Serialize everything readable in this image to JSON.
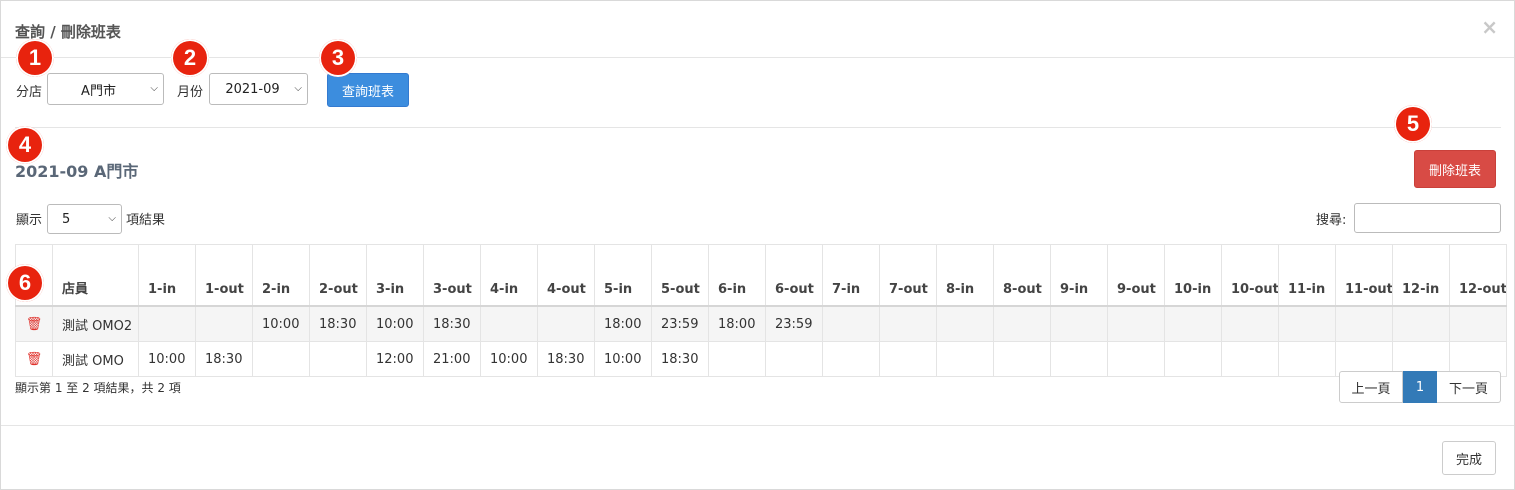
{
  "modal": {
    "title": "查詢 / 刪除班表",
    "close_glyph": "×"
  },
  "filters": {
    "store_label": "分店",
    "store_value": "A門市",
    "month_label": "月份",
    "month_value": "2021-09",
    "query_button": "查詢班表"
  },
  "section": {
    "heading": "2021-09 A門市",
    "delete_button": "刪除班表"
  },
  "datatable": {
    "show_label": "顯示",
    "page_size": "5",
    "entries_label": "項結果",
    "search_label": "搜尋:",
    "columns": [
      "",
      "店員",
      "1-in",
      "1-out",
      "2-in",
      "2-out",
      "3-in",
      "3-out",
      "4-in",
      "4-out",
      "5-in",
      "5-out",
      "6-in",
      "6-out",
      "7-in",
      "7-out",
      "8-in",
      "8-out",
      "9-in",
      "9-out",
      "10-in",
      "10-out",
      "11-in",
      "11-out",
      "12-in",
      "12-out"
    ],
    "rows": [
      [
        "",
        "測試 OMO2",
        "",
        "",
        "10:00",
        "18:30",
        "10:00",
        "18:30",
        "",
        "",
        "18:00",
        "23:59",
        "18:00",
        "23:59",
        "",
        "",
        "",
        "",
        "",
        "",
        "",
        "",
        "",
        "",
        "",
        ""
      ],
      [
        "",
        "測試 OMO",
        "10:00",
        "18:30",
        "",
        "",
        "12:00",
        "21:00",
        "10:00",
        "18:30",
        "10:00",
        "18:30",
        "",
        "",
        "",
        "",
        "",
        "",
        "",
        "",
        "",
        "",
        "",
        "",
        "",
        ""
      ]
    ],
    "info": "顯示第 1 至 2 項結果，共 2 項",
    "pagination": {
      "prev": "上一頁",
      "current": "1",
      "next": "下一頁"
    }
  },
  "footer": {
    "done_button": "完成"
  },
  "markers": [
    "1",
    "2",
    "3",
    "4",
    "5",
    "6"
  ],
  "colors": {
    "primary": "#3c8dde",
    "danger": "#d84b45",
    "marker": "#e8230e",
    "page_active": "#337ab7"
  },
  "icons": {
    "trash": "trash-icon",
    "chevron": "chevron-down-icon",
    "close": "close-icon"
  }
}
